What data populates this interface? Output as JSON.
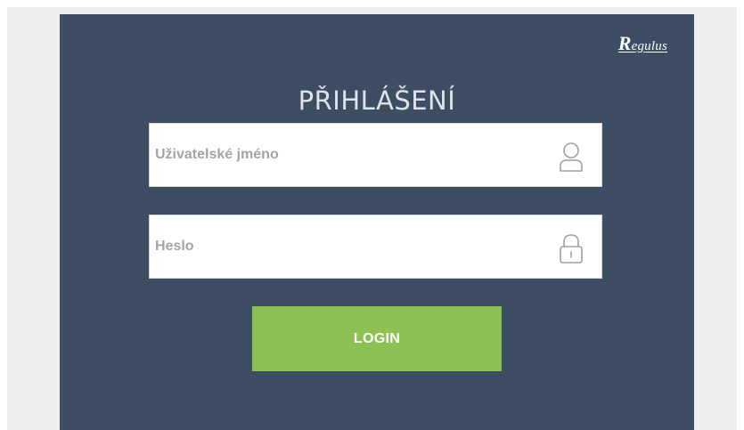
{
  "brand": {
    "logo_initial": "R",
    "logo_rest": "egulus"
  },
  "login": {
    "title": "PŘIHLÁŠENÍ",
    "username_placeholder": "Uživatelské jméno",
    "username_value": "",
    "password_placeholder": "Heslo",
    "password_value": "",
    "submit_label": "LOGIN"
  },
  "colors": {
    "page_background": "#efefef",
    "panel_background": "#3d4e64",
    "button_background": "#8dc153",
    "icon_stroke": "#a0a0a0"
  },
  "icons": {
    "username": "user-icon",
    "password": "lock-icon"
  }
}
